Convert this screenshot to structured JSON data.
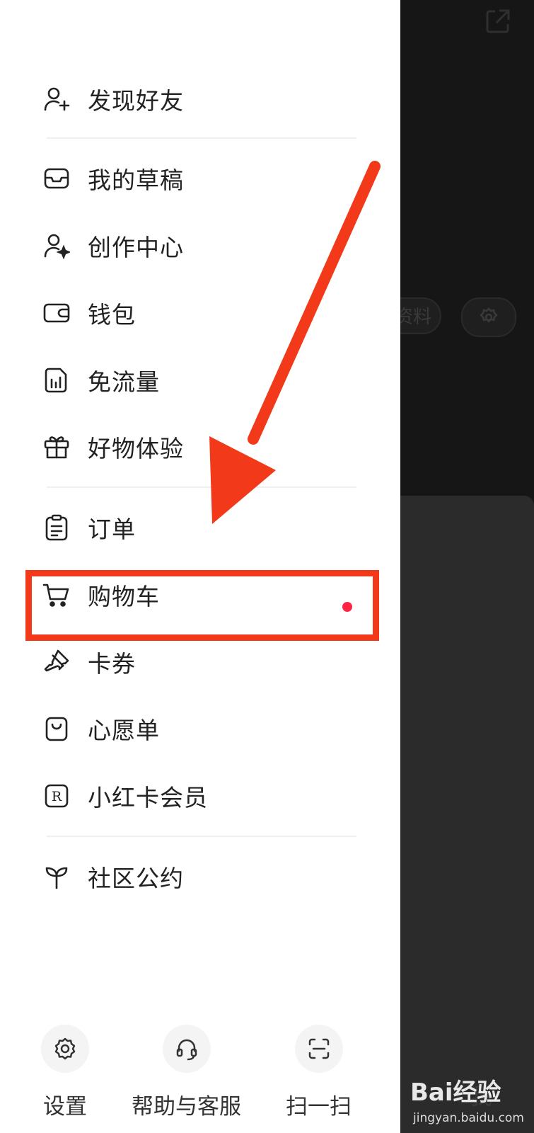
{
  "drawer": {
    "items": [
      {
        "label": "发现好友",
        "icon": "add-user-icon"
      },
      {
        "label": "我的草稿",
        "icon": "drafts-inbox-icon"
      },
      {
        "label": "创作中心",
        "icon": "creator-icon"
      },
      {
        "label": "钱包",
        "icon": "wallet-icon"
      },
      {
        "label": "免流量",
        "icon": "data-free-icon"
      },
      {
        "label": "好物体验",
        "icon": "gift-icon"
      },
      {
        "label": "订单",
        "icon": "order-clipboard-icon"
      },
      {
        "label": "购物车",
        "icon": "cart-icon",
        "badge": "red-dot"
      },
      {
        "label": "卡券",
        "icon": "coupon-icon"
      },
      {
        "label": "心愿单",
        "icon": "wishlist-bag-icon"
      },
      {
        "label": "小红卡会员",
        "icon": "membership-r-icon"
      },
      {
        "label": "社区公约",
        "icon": "sprout-icon"
      }
    ],
    "bottom": [
      {
        "label": "设置",
        "icon": "gear-icon"
      },
      {
        "label": "帮助与客服",
        "icon": "headset-icon"
      },
      {
        "label": "扫一扫",
        "icon": "scan-icon"
      }
    ]
  },
  "background": {
    "profile_pill_text": "资料",
    "tab_me": "我"
  },
  "annotation": {
    "highlight_color": "#f23a1a",
    "highlighted_item": "购物车"
  },
  "watermark": {
    "logo": "Bai经验",
    "url": "jingyan.baidu.com"
  },
  "colors": {
    "badge": "#ff2442",
    "annotation": "#f23a1a"
  }
}
